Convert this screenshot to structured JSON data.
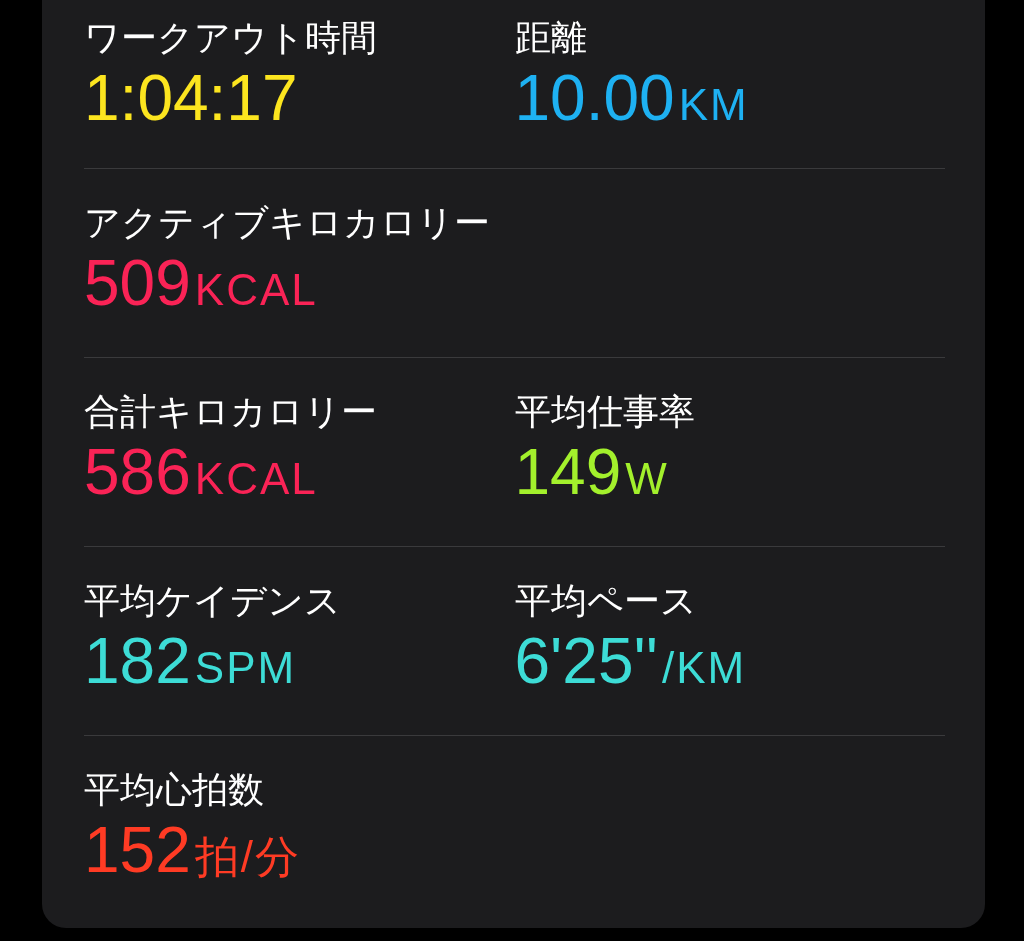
{
  "rows": [
    {
      "metrics": [
        {
          "label": "ワークアウト時間",
          "value": "1:04:17",
          "color": "#fce51f"
        },
        {
          "label": "距離",
          "value": "10.00",
          "unit": "KM",
          "color": "#1eb1f2"
        }
      ]
    },
    {
      "metrics": [
        {
          "label": "アクティブキロカロリー",
          "value": "509",
          "unit": "KCAL",
          "color": "#fa2356"
        }
      ]
    },
    {
      "metrics": [
        {
          "label": "合計キロカロリー",
          "value": "586",
          "unit": "KCAL",
          "color": "#fa2356"
        },
        {
          "label": "平均仕事率",
          "value": "149",
          "unit": "W",
          "color": "#a3f02c"
        }
      ]
    },
    {
      "metrics": [
        {
          "label": "平均ケイデンス",
          "value": "182",
          "unit": "SPM",
          "color": "#3ddcd6"
        },
        {
          "label": "平均ペース",
          "value": "6'25''",
          "unit": "/KM",
          "color": "#3ddcd6"
        }
      ]
    },
    {
      "metrics": [
        {
          "label": "平均心拍数",
          "value": "152",
          "unit": "拍/分",
          "color": "#ff3b24"
        }
      ]
    }
  ]
}
